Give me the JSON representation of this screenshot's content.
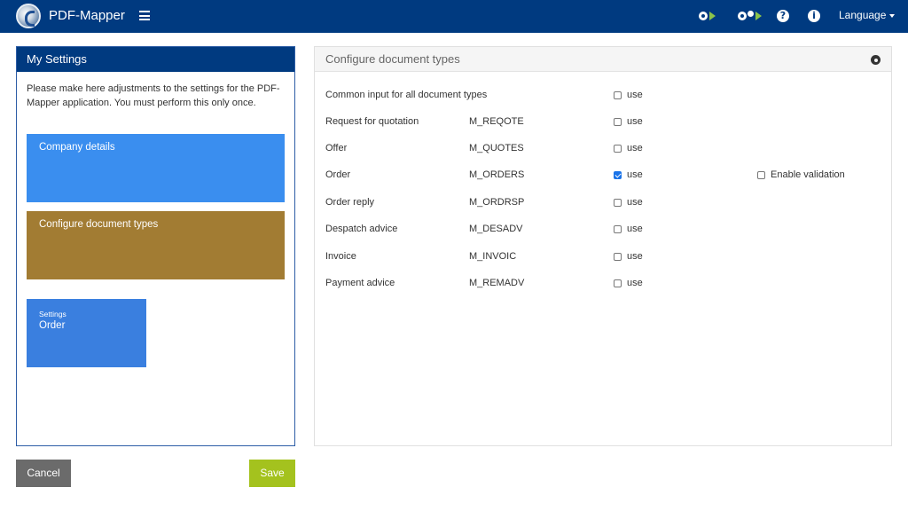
{
  "app": {
    "title": "PDF-Mapper",
    "language_label": "Language"
  },
  "left_panel": {
    "title": "My Settings",
    "intro": "Please make here adjustments to the settings for the PDF-Mapper application. You must perform this only once.",
    "tiles": {
      "company": "Company details",
      "doc_types": "Configure document types",
      "settings_small": "Settings",
      "settings_big": "Order"
    }
  },
  "buttons": {
    "cancel": "Cancel",
    "save": "Save"
  },
  "right_panel": {
    "title": "Configure document types",
    "rows": [
      {
        "name": "Common input for all document types",
        "code": "",
        "use_label": "use",
        "checked": false
      },
      {
        "name": "Request for quotation",
        "code": "M_REQOTE",
        "use_label": "use",
        "checked": false
      },
      {
        "name": "Offer",
        "code": "M_QUOTES",
        "use_label": "use",
        "checked": false
      },
      {
        "name": "Order",
        "code": "M_ORDERS",
        "use_label": "use",
        "checked": true,
        "validation_label": "Enable validation",
        "validation_checked": false
      },
      {
        "name": "Order reply",
        "code": "M_ORDRSP",
        "use_label": "use",
        "checked": false
      },
      {
        "name": "Despatch advice",
        "code": "M_DESADV",
        "use_label": "use",
        "checked": false
      },
      {
        "name": "Invoice",
        "code": "M_INVOIC",
        "use_label": "use",
        "checked": false
      },
      {
        "name": "Payment advice",
        "code": "M_REMADV",
        "use_label": "use",
        "checked": false
      }
    ]
  },
  "colors": {
    "topbar": "#003a80",
    "company_tile": "#3a8eef",
    "doc_tile": "#a27c33",
    "settings_tile": "#3a7fdf",
    "save_button": "#a4c21e",
    "cancel_button": "#6b6b6b",
    "play_accent": "#8bc34a"
  },
  "icons": [
    "app-logo-icon",
    "hamburger-menu-icon",
    "gear-play-icon",
    "gears-play-icon",
    "help-icon",
    "info-icon",
    "caret-down-icon",
    "settings-gear-icon"
  ]
}
